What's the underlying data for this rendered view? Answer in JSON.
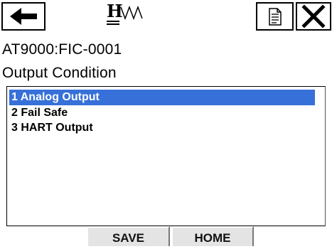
{
  "header": {
    "back_icon": "left-arrow-icon",
    "logo_letter": "H",
    "doc_icon": "document-icon",
    "close_icon": "close-icon"
  },
  "device": {
    "tag": "AT9000:FIC-0001"
  },
  "menu": {
    "title": "Output Condition",
    "items": [
      {
        "label": "1 Analog Output",
        "selected": true
      },
      {
        "label": "2 Fail Safe",
        "selected": false
      },
      {
        "label": "3 HART Output",
        "selected": false
      }
    ]
  },
  "footer": {
    "save_label": "SAVE",
    "home_label": "HOME"
  },
  "colors": {
    "selection": "#3670d8",
    "button_face": "#e4e4e4"
  }
}
